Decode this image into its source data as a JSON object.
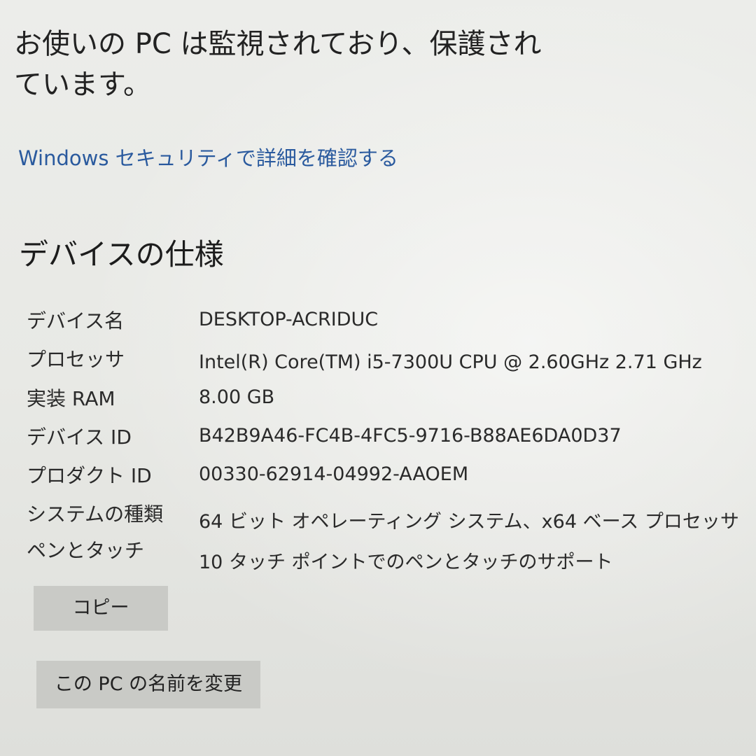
{
  "security": {
    "status_text": "お使いの PC は監視されており、保護されています。",
    "link_text": "Windows セキュリティで詳細を確認する"
  },
  "device_specs": {
    "title": "デバイスの仕様",
    "rows": [
      {
        "label": "デバイス名",
        "value": "DESKTOP-ACRIDUC"
      },
      {
        "label": "プロセッサ",
        "value": "Intel(R) Core(TM) i5-7300U CPU @ 2.60GHz   2.71 GHz"
      },
      {
        "label": "実装 RAM",
        "value": "8.00 GB"
      },
      {
        "label": "デバイス ID",
        "value": "B42B9A46-FC4B-4FC5-9716-B88AE6DA0D37"
      },
      {
        "label": "プロダクト ID",
        "value": "00330-62914-04992-AAOEM"
      },
      {
        "label": "システムの種類",
        "value": "64 ビット オペレーティング システム、x64 ベース プロセッサ"
      },
      {
        "label": "ペンとタッチ",
        "value": "10 タッチ ポイントでのペンとタッチのサポート"
      }
    ],
    "copy_button": "コピー",
    "rename_button": "この PC の名前を変更"
  },
  "colors": {
    "link": "#2a5a9e",
    "button_bg": "#c9cac6",
    "background": "#e6e7e3"
  }
}
